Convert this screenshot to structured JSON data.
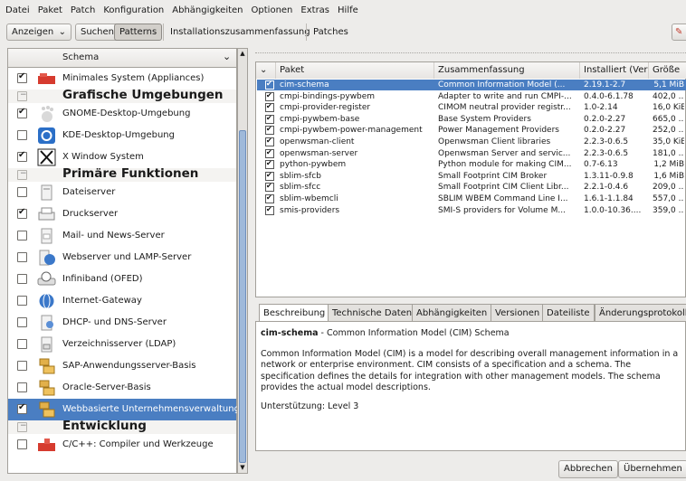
{
  "menu": [
    "Datei",
    "Paket",
    "Patch",
    "Konfiguration",
    "Abhängigkeiten",
    "Optionen",
    "Extras",
    "Hilfe"
  ],
  "toolbar": {
    "view_dropdown": "Anzeigen",
    "search": "Suchen",
    "patterns": "Patterns",
    "install_summary": "Installationszusammenfassung",
    "patches": "Patches",
    "accent": "#4a7ec2"
  },
  "left": {
    "header": "Schema",
    "items": [
      {
        "label": "Minimales System (Appliances)",
        "state": "checked",
        "icon": "appliance-icon"
      },
      {
        "label": "Grafische Umgebungen",
        "state": "category"
      },
      {
        "label": "GNOME-Desktop-Umgebung",
        "state": "checked",
        "icon": "gnome-foot-icon"
      },
      {
        "label": "KDE-Desktop-Umgebung",
        "state": "unchecked",
        "icon": "kde-gear-icon"
      },
      {
        "label": "X Window System",
        "state": "checked",
        "icon": "x-logo-icon"
      },
      {
        "label": "Primäre Funktionen",
        "state": "category"
      },
      {
        "label": "Dateiserver",
        "state": "unchecked",
        "icon": "file-server-icon"
      },
      {
        "label": "Druckserver",
        "state": "checked",
        "icon": "printer-icon"
      },
      {
        "label": "Mail- und News-Server",
        "state": "unchecked",
        "icon": "mail-server-icon"
      },
      {
        "label": "Webserver und LAMP-Server",
        "state": "unchecked",
        "icon": "web-server-icon"
      },
      {
        "label": "Infiniband (OFED)",
        "state": "unchecked",
        "icon": "network-drive-icon"
      },
      {
        "label": "Internet-Gateway",
        "state": "unchecked",
        "icon": "globe-icon"
      },
      {
        "label": "DHCP- und DNS-Server",
        "state": "unchecked",
        "icon": "dhcp-dns-icon"
      },
      {
        "label": "Verzeichnisserver (LDAP)",
        "state": "unchecked",
        "icon": "directory-server-icon"
      },
      {
        "label": "SAP-Anwendungsserver-Basis",
        "state": "unchecked",
        "icon": "database-icon"
      },
      {
        "label": "Oracle-Server-Basis",
        "state": "unchecked",
        "icon": "database-icon"
      },
      {
        "label": "Webbasierte Unternehmensverwaltung",
        "state": "checked",
        "icon": "database-icon",
        "selected": true
      },
      {
        "label": "Entwicklung",
        "state": "category"
      },
      {
        "label": "C/C++: Compiler und Werkzeuge",
        "state": "unchecked",
        "icon": "compiler-icon"
      }
    ]
  },
  "table": {
    "columns": [
      "Paket",
      "Zusammenfassung",
      "Installiert (Ver",
      "Größe"
    ],
    "rows": [
      {
        "name": "cim-schema",
        "summary": "Common Information Model (...",
        "version": "2.19.1-2.7",
        "size": "5,1 MiB",
        "selected": true
      },
      {
        "name": "cmpi-bindings-pywbem",
        "summary": "Adapter to write and run CMPI-...",
        "version": "0.4.0-6.1.78",
        "size": "402,0 ..."
      },
      {
        "name": "cmpi-provider-register",
        "summary": "CIMOM neutral provider registr...",
        "version": "1.0-2.14",
        "size": "16,0 KiB"
      },
      {
        "name": "cmpi-pywbem-base",
        "summary": "Base System Providers",
        "version": "0.2.0-2.27",
        "size": "665,0 ..."
      },
      {
        "name": "cmpi-pywbem-power-management",
        "summary": "Power Management Providers",
        "version": "0.2.0-2.27",
        "size": "252,0 ..."
      },
      {
        "name": "openwsman-client",
        "summary": "Openwsman Client libraries",
        "version": "2.2.3-0.6.5",
        "size": "35,0 KiB"
      },
      {
        "name": "openwsman-server",
        "summary": "Openwsman Server and servic...",
        "version": "2.2.3-0.6.5",
        "size": "181,0 ..."
      },
      {
        "name": "python-pywbem",
        "summary": "Python module for making CIM...",
        "version": "0.7-6.13",
        "size": "1,2 MiB"
      },
      {
        "name": "sblim-sfcb",
        "summary": "Small Footprint CIM Broker",
        "version": "1.3.11-0.9.8",
        "size": "1,6 MiB"
      },
      {
        "name": "sblim-sfcc",
        "summary": "Small Footprint CIM Client Libr...",
        "version": "2.2.1-0.4.6",
        "size": "209,0 ..."
      },
      {
        "name": "sblim-wbemcli",
        "summary": "SBLIM WBEM Command Line I...",
        "version": "1.6.1-1.1.84",
        "size": "557,0 ..."
      },
      {
        "name": "smis-providers",
        "summary": "SMI-S providers for Volume M...",
        "version": "1.0.0-10.36....",
        "size": "359,0 ..."
      }
    ]
  },
  "detail": {
    "tabs": [
      "Beschreibung",
      "Technische Daten",
      "Abhängigkeiten",
      "Versionen",
      "Dateiliste",
      "Änderungsprotokoll"
    ],
    "pkg_name": "cim-schema",
    "pkg_summary": " - Common Information Model (CIM) Schema",
    "description": "Common Information Model (CIM) is a model for describing overall management information in a network or enterprise environment. CIM consists of a specification and a schema. The specification defines the details for integration with other management models. The schema provides the actual model descriptions.",
    "support": "Unterstützung: Level 3"
  },
  "buttons": {
    "cancel": "Abbrechen",
    "accept": "Übernehmen"
  }
}
